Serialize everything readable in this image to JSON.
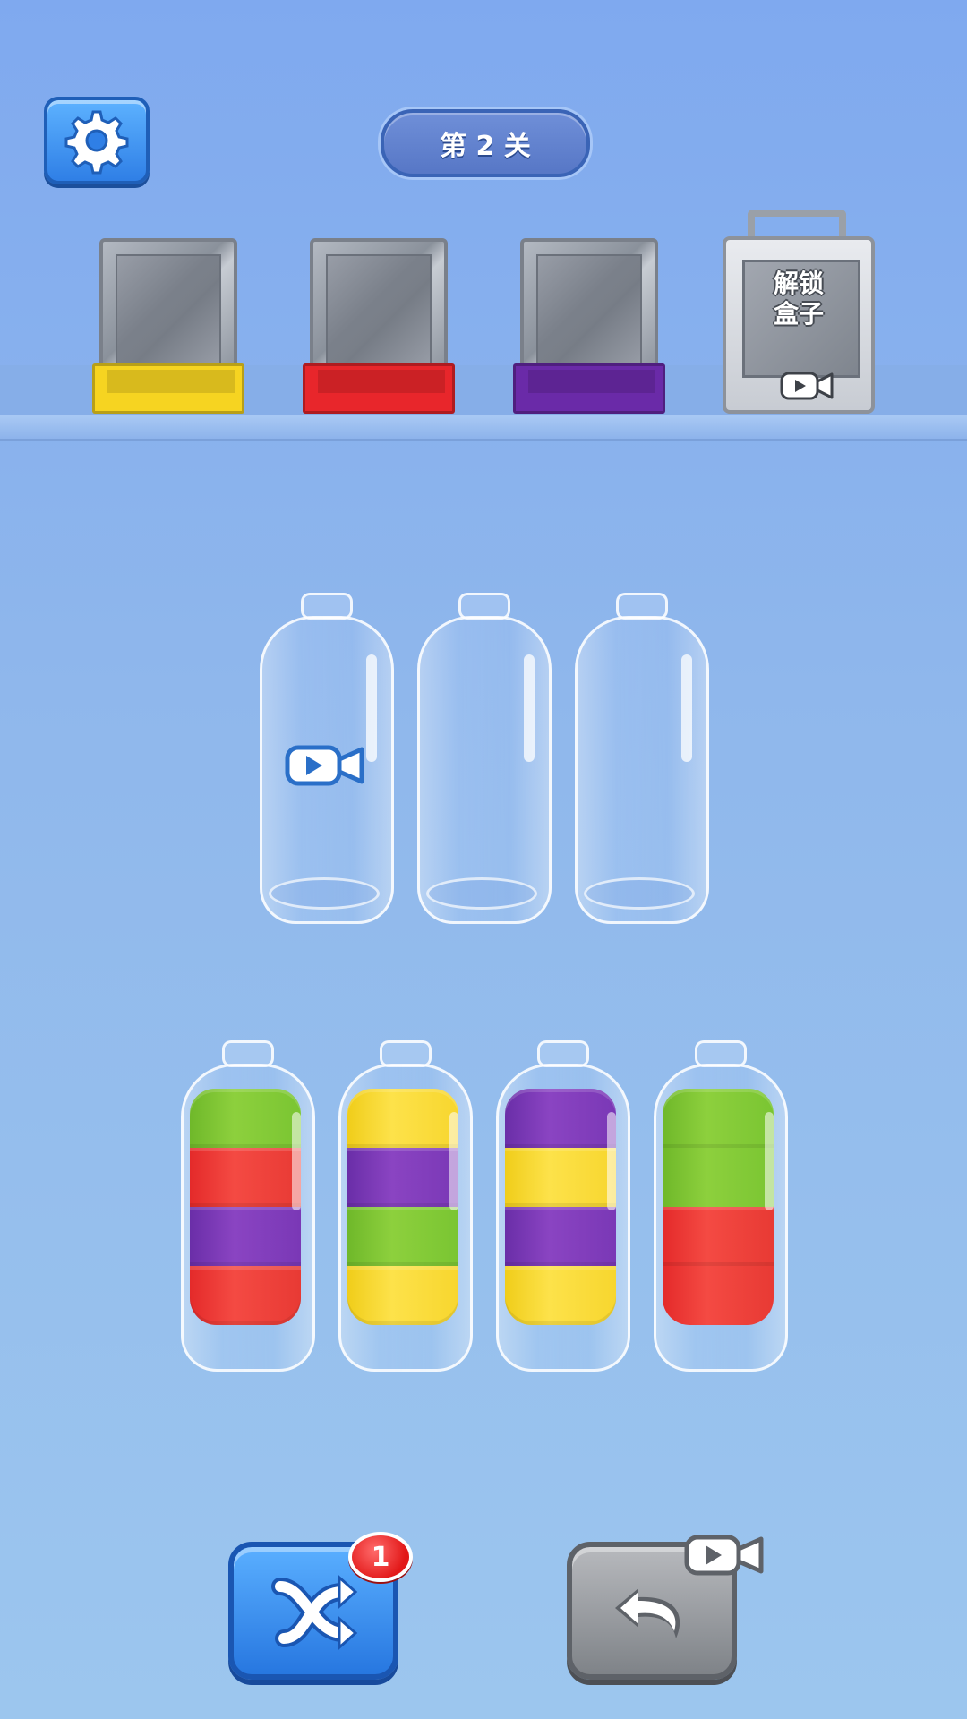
{
  "header": {
    "settings_icon": "gear-icon",
    "level_label": "第 2 关"
  },
  "boxes": [
    {
      "color": "#f6d421",
      "locked": false
    },
    {
      "color": "#e8262b",
      "locked": false
    },
    {
      "color": "#6a2aa8",
      "locked": false
    },
    {
      "color": "#d9dbe0",
      "locked": true,
      "label_line1": "解锁",
      "label_line2": "盒子",
      "icon": "video-icon"
    }
  ],
  "empty_bottles": [
    {
      "locked": true,
      "icon": "video-icon"
    },
    {
      "locked": false
    },
    {
      "locked": false
    }
  ],
  "filled_bottles": [
    {
      "layers_top_to_bottom": [
        "green",
        "red",
        "purple",
        "red"
      ]
    },
    {
      "layers_top_to_bottom": [
        "yellow",
        "purple",
        "green",
        "yellow"
      ]
    },
    {
      "layers_top_to_bottom": [
        "purple",
        "yellow",
        "purple",
        "yellow"
      ]
    },
    {
      "layers_top_to_bottom": [
        "green",
        "green",
        "red",
        "red"
      ]
    }
  ],
  "bottom_bar": {
    "shuffle_icon": "shuffle-icon",
    "shuffle_count": "1",
    "undo_icon": "undo-icon",
    "undo_ad_icon": "video-icon"
  }
}
